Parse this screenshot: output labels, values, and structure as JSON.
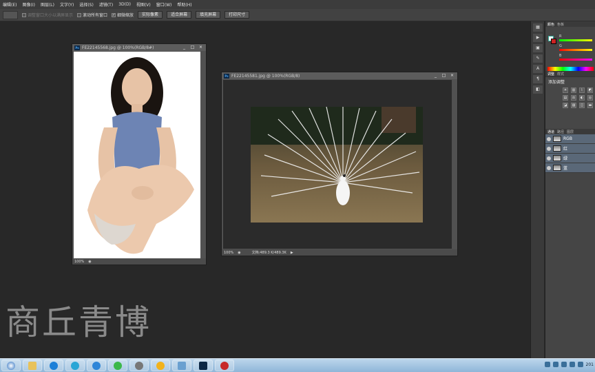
{
  "menubar": {
    "items": [
      "编辑(E)",
      "图像(I)",
      "图层(L)",
      "文字(Y)",
      "选择(S)",
      "滤镜(T)",
      "3D(D)",
      "视图(V)",
      "窗口(W)",
      "帮助(H)"
    ]
  },
  "options": {
    "all_windows": "滚动所有窗口",
    "fine_zoom": "细微缩放",
    "btn_actual": "实际像素",
    "btn_fit": "适合屏幕",
    "btn_fill": "填充屏幕",
    "btn_print": "打印尺寸",
    "faded_label": "调整窗口大小以满屏显示"
  },
  "doc1": {
    "title": "FE22145568.jpg @ 100%(RGB/8#)",
    "zoom": "100%"
  },
  "doc2": {
    "title": "FE22145581.jpg @ 100%(RGB/8)",
    "zoom": "100%",
    "docsize": "文档:489.3 K/489.3K"
  },
  "panels": {
    "color_tabs": [
      "颜色",
      "色板"
    ],
    "r": "R",
    "g": "G",
    "b": "B",
    "adj_tabs": [
      "调整",
      "样式"
    ],
    "adj_title": "添加调整",
    "chan_tabs": [
      "通道",
      "路径",
      "图层"
    ],
    "channels": [
      "RGB",
      "红",
      "绿",
      "蓝"
    ]
  },
  "watermark": "商丘青博",
  "tray": {
    "time": "201"
  },
  "colors": {
    "accent_selected": "#5a6878",
    "fg_swatch": "#ffffff",
    "bg_swatch": "#cc2222"
  }
}
